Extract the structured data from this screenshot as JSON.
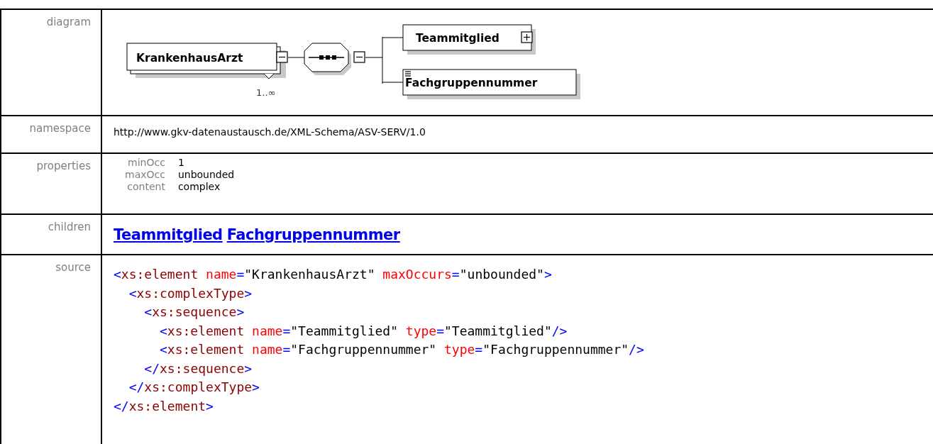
{
  "rows": [
    {
      "kind": "diagram",
      "label": "diagram",
      "element": {
        "name": "KrankenhausArzt",
        "occurrence": "1..∞",
        "expanded": true
      },
      "compositor": {
        "expanded": true
      },
      "children": [
        {
          "name": "Teammitglied",
          "kind": "complex",
          "expanded": false
        },
        {
          "name": "Fachgruppennummer",
          "kind": "simple"
        }
      ]
    },
    {
      "kind": "namespace",
      "label": "namespace",
      "value": "http://www.gkv-datenaustausch.de/XML-Schema/ASV-SERV/1.0"
    },
    {
      "kind": "properties",
      "label": "properties",
      "items": [
        {
          "name": "minOcc",
          "value": "1"
        },
        {
          "name": "maxOcc",
          "value": "unbounded"
        },
        {
          "name": "content",
          "value": "complex"
        }
      ]
    },
    {
      "kind": "children",
      "label": "children",
      "links": [
        "Teammitglied",
        "Fachgruppennummer"
      ]
    },
    {
      "kind": "source",
      "label": "source",
      "lines": [
        [
          {
            "kind": "bracket",
            "text": "<"
          },
          {
            "kind": "tag",
            "text": "xs:element"
          },
          {
            "kind": "attr",
            "text": " name"
          },
          {
            "kind": "bracket",
            "text": "="
          },
          {
            "kind": "value",
            "text": "\"KrankenhausArzt\""
          },
          {
            "kind": "attr",
            "text": " maxOccurs"
          },
          {
            "kind": "bracket",
            "text": "="
          },
          {
            "kind": "value",
            "text": "\"unbounded\""
          },
          {
            "kind": "bracket",
            "text": ">"
          }
        ],
        [
          {
            "kind": "bracket",
            "text": "  <"
          },
          {
            "kind": "tag",
            "text": "xs:complexType"
          },
          {
            "kind": "bracket",
            "text": ">"
          }
        ],
        [
          {
            "kind": "bracket",
            "text": "    <"
          },
          {
            "kind": "tag",
            "text": "xs:sequence"
          },
          {
            "kind": "bracket",
            "text": ">"
          }
        ],
        [
          {
            "kind": "bracket",
            "text": "      <"
          },
          {
            "kind": "tag",
            "text": "xs:element"
          },
          {
            "kind": "attr",
            "text": " name"
          },
          {
            "kind": "bracket",
            "text": "="
          },
          {
            "kind": "value",
            "text": "\"Teammitglied\""
          },
          {
            "kind": "attr",
            "text": " type"
          },
          {
            "kind": "bracket",
            "text": "="
          },
          {
            "kind": "value",
            "text": "\"Teammitglied\""
          },
          {
            "kind": "bracket",
            "text": "/>"
          }
        ],
        [
          {
            "kind": "bracket",
            "text": "      <"
          },
          {
            "kind": "tag",
            "text": "xs:element"
          },
          {
            "kind": "attr",
            "text": " name"
          },
          {
            "kind": "bracket",
            "text": "="
          },
          {
            "kind": "value",
            "text": "\"Fachgruppennummer\""
          },
          {
            "kind": "attr",
            "text": " type"
          },
          {
            "kind": "bracket",
            "text": "="
          },
          {
            "kind": "value",
            "text": "\"Fachgruppennummer\""
          },
          {
            "kind": "bracket",
            "text": "/>"
          }
        ],
        [
          {
            "kind": "bracket",
            "text": "    </"
          },
          {
            "kind": "tag",
            "text": "xs:sequence"
          },
          {
            "kind": "bracket",
            "text": ">"
          }
        ],
        [
          {
            "kind": "bracket",
            "text": "  </"
          },
          {
            "kind": "tag",
            "text": "xs:complexType"
          },
          {
            "kind": "bracket",
            "text": ">"
          }
        ],
        [
          {
            "kind": "bracket",
            "text": "</"
          },
          {
            "kind": "tag",
            "text": "xs:element"
          },
          {
            "kind": "bracket",
            "text": ">"
          }
        ]
      ]
    }
  ]
}
